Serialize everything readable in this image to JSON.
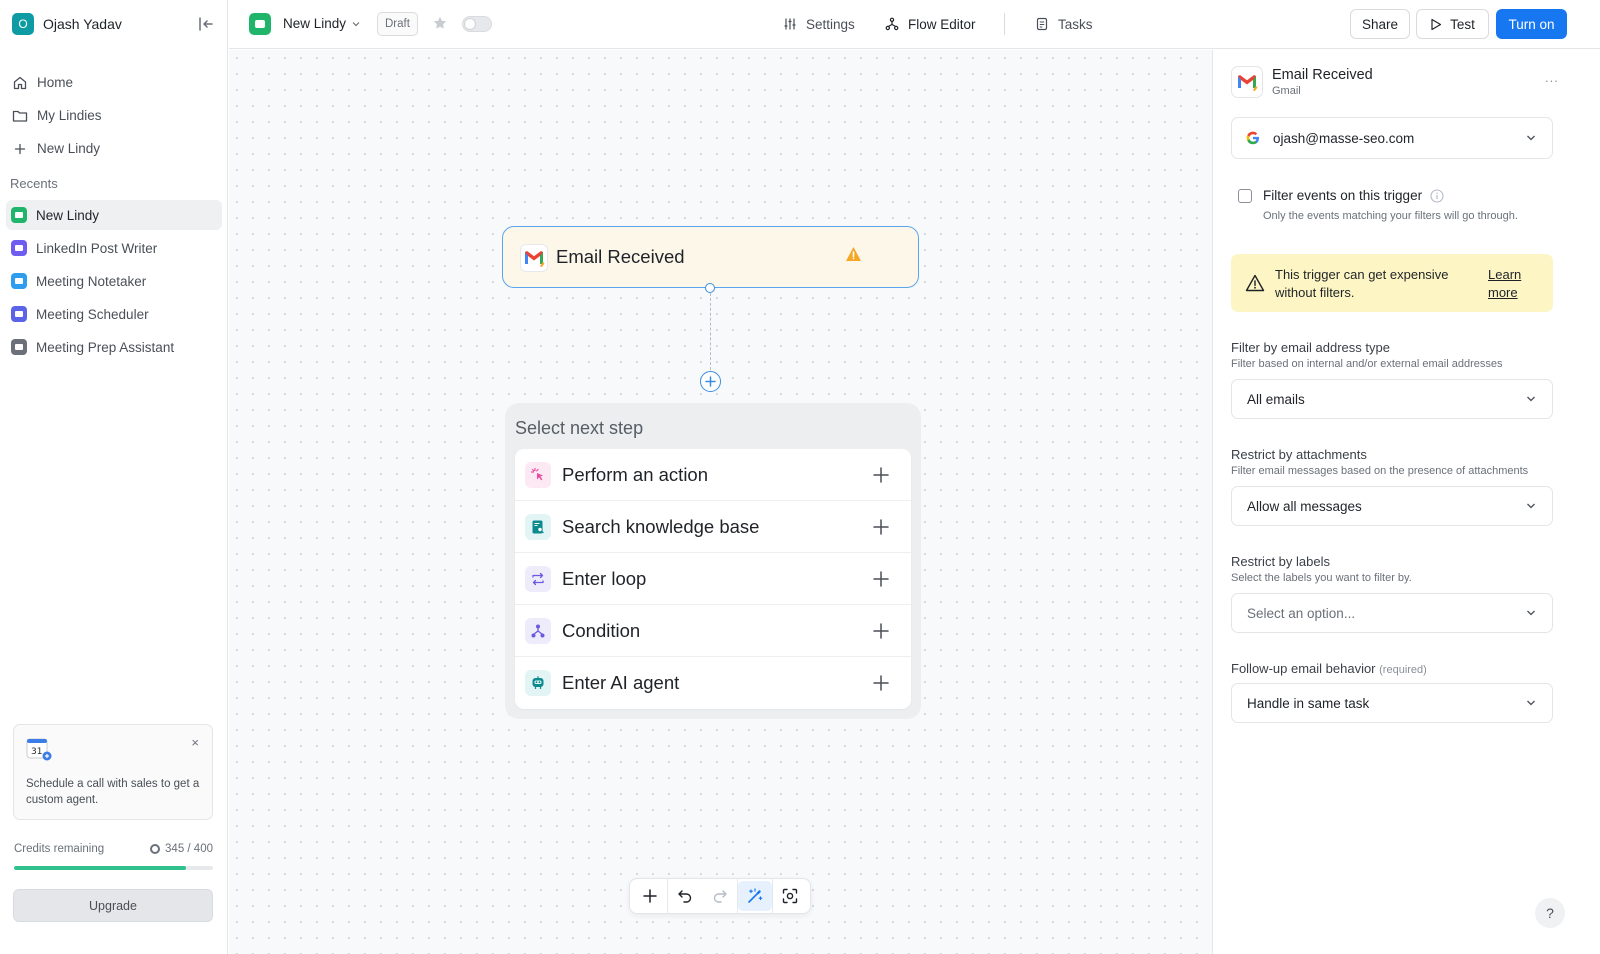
{
  "sidebar": {
    "workspace": {
      "initial": "O",
      "name": "Ojash Yadav"
    },
    "nav": [
      {
        "label": "Home",
        "icon": "home-icon"
      },
      {
        "label": "My Lindies",
        "icon": "folder-icon"
      },
      {
        "label": "New Lindy",
        "icon": "plus-icon"
      }
    ],
    "recents_title": "Recents",
    "recents": [
      {
        "label": "New Lindy",
        "color": "#21b56b",
        "active": true
      },
      {
        "label": "LinkedIn Post Writer",
        "color": "#6f5cf0"
      },
      {
        "label": "Meeting Notetaker",
        "color": "#2e9df0"
      },
      {
        "label": "Meeting Scheduler",
        "color": "#5b63e6"
      },
      {
        "label": "Meeting Prep Assistant",
        "color": "#6b7079"
      }
    ],
    "promo": {
      "calendar_day": "31",
      "text": "Schedule a call with sales to get a custom agent."
    },
    "credits": {
      "label": "Credits remaining",
      "value": "345 / 400",
      "used": 345,
      "total": 400
    },
    "upgrade_label": "Upgrade"
  },
  "topbar": {
    "app_name": "New Lindy",
    "status": "Draft",
    "nav": {
      "settings": "Settings",
      "flow_editor": "Flow Editor",
      "tasks": "Tasks"
    },
    "share_label": "Share",
    "test_label": "Test",
    "turn_on_label": "Turn on",
    "accent": "#1677f0"
  },
  "canvas": {
    "trigger": {
      "title": "Email Received"
    },
    "select_next": {
      "title": "Select next step",
      "items": [
        {
          "label": "Perform an action",
          "icon": "sparkle-cursor-icon",
          "color": "#e94fa0",
          "bg": "#fde9f3"
        },
        {
          "label": "Search knowledge base",
          "icon": "knowledge-base-icon",
          "color": "#0b8a8f",
          "bg": "#e3f4f4"
        },
        {
          "label": "Enter loop",
          "icon": "loop-icon",
          "color": "#6b5ae0",
          "bg": "#eeecfb"
        },
        {
          "label": "Condition",
          "icon": "condition-icon",
          "color": "#6b5ae0",
          "bg": "#eeecfb"
        },
        {
          "label": "Enter AI agent",
          "icon": "robot-icon",
          "color": "#0b8a8f",
          "bg": "#e3f4f4"
        }
      ]
    }
  },
  "panel": {
    "title": "Email Received",
    "subtitle": "Gmail",
    "more": "...",
    "account_email": "ojash@masse-seo.com",
    "filter_label": "Filter events on this trigger",
    "filter_help": "Only the events matching your filters will go through.",
    "warning": {
      "text": "This trigger can get expensive without filters.",
      "link": "Learn more"
    },
    "fields": [
      {
        "label": "Filter by email address type",
        "help": "Filter based on internal and/or external email addresses",
        "value": "All emails",
        "placeholder": false
      },
      {
        "label": "Restrict by attachments",
        "help": "Filter email messages based on the presence of attachments",
        "value": "Allow all messages",
        "placeholder": false
      },
      {
        "label": "Restrict by labels",
        "help": "Select the labels you want to filter by.",
        "value": "Select an option...",
        "placeholder": true
      },
      {
        "label": "Follow-up email behavior",
        "required": "(required)",
        "value": "Handle in same task",
        "placeholder": false
      }
    ]
  },
  "help_label": "?"
}
